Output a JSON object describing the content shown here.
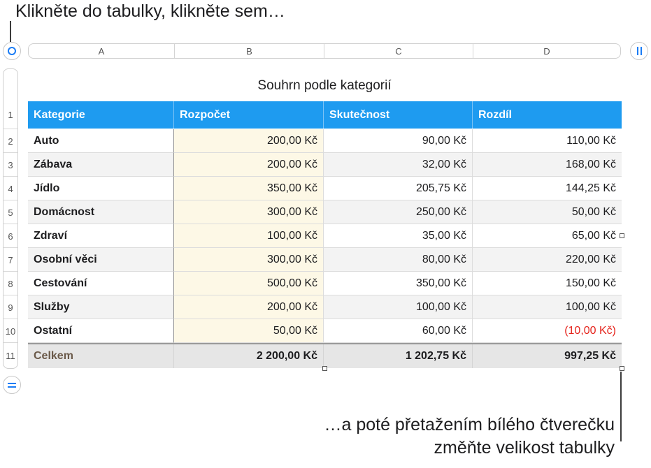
{
  "callouts": {
    "top": "Klikněte do tabulky, klikněte sem…",
    "bottom_line1": "…a poté přetažením bílého čtverečku",
    "bottom_line2": "změňte velikost tabulky"
  },
  "columns": [
    "A",
    "B",
    "C",
    "D"
  ],
  "row_numbers": [
    "1",
    "2",
    "3",
    "4",
    "5",
    "6",
    "7",
    "8",
    "9",
    "10",
    "11"
  ],
  "table": {
    "title": "Souhrn podle kategorií",
    "headers": [
      "Kategorie",
      "Rozpočet",
      "Skutečnost",
      "Rozdíl"
    ],
    "rows": [
      [
        "Auto",
        "200,00 Kč",
        "90,00 Kč",
        "110,00 Kč"
      ],
      [
        "Zábava",
        "200,00 Kč",
        "32,00 Kč",
        "168,00 Kč"
      ],
      [
        "Jídlo",
        "350,00 Kč",
        "205,75 Kč",
        "144,25 Kč"
      ],
      [
        "Domácnost",
        "300,00 Kč",
        "250,00 Kč",
        "50,00 Kč"
      ],
      [
        "Zdraví",
        "100,00 Kč",
        "35,00 Kč",
        "65,00 Kč"
      ],
      [
        "Osobní věci",
        "300,00 Kč",
        "80,00 Kč",
        "220,00 Kč"
      ],
      [
        "Cestování",
        "500,00 Kč",
        "350,00 Kč",
        "150,00 Kč"
      ],
      [
        "Služby",
        "200,00 Kč",
        "100,00 Kč",
        "100,00 Kč"
      ],
      [
        "Ostatní",
        "50,00 Kč",
        "60,00 Kč",
        "(10,00 Kč)"
      ]
    ],
    "footer": [
      "Celkem",
      "2 200,00 Kč",
      "1 202,75 Kč",
      "997,25 Kč"
    ]
  },
  "colors": {
    "header": "#1e9bf0",
    "accent": "#1a7cf5",
    "negative": "#e5231b",
    "budget_fill": "#fdf8e6"
  }
}
